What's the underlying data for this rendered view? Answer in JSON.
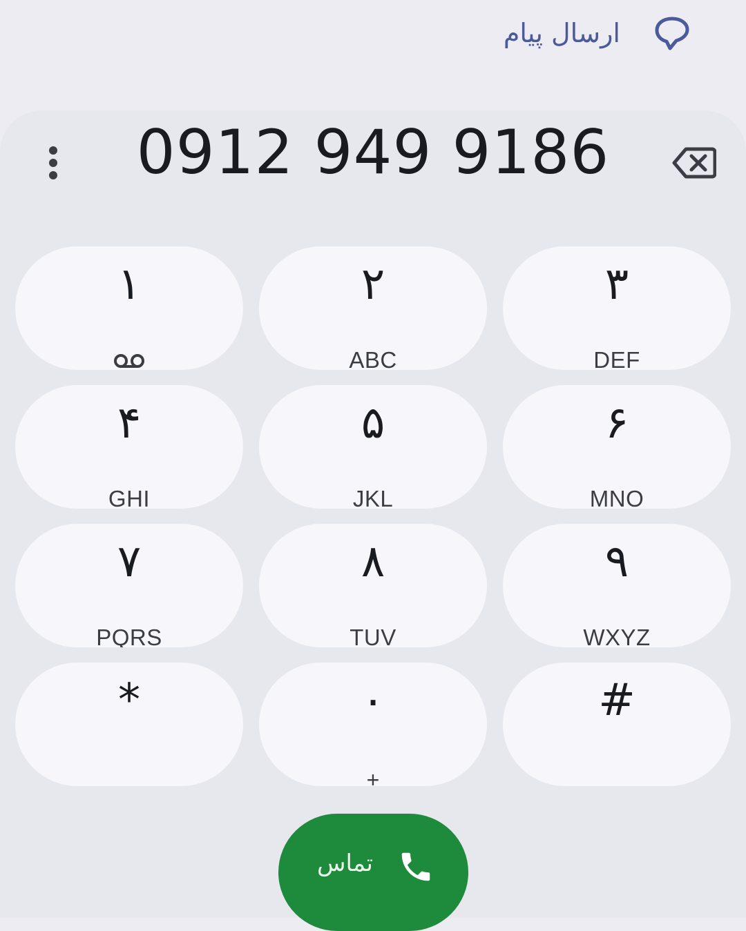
{
  "header": {
    "send_message_label": "ارسال پیام",
    "send_message_icon": "chat-bubble-icon"
  },
  "dialer": {
    "phone_number": "0912 949 9186",
    "menu_icon": "more-vert-icon",
    "backspace_icon": "backspace-icon",
    "keys": [
      {
        "digit": "۱",
        "letters": "",
        "sub_icon": "voicemail-icon"
      },
      {
        "digit": "۲",
        "letters": "ABC"
      },
      {
        "digit": "۳",
        "letters": "DEF"
      },
      {
        "digit": "۴",
        "letters": "GHI"
      },
      {
        "digit": "۵",
        "letters": "JKL"
      },
      {
        "digit": "۶",
        "letters": "MNO"
      },
      {
        "digit": "۷",
        "letters": "PQRS"
      },
      {
        "digit": "۸",
        "letters": "TUV"
      },
      {
        "digit": "۹",
        "letters": "WXYZ"
      },
      {
        "digit": "*",
        "letters": ""
      },
      {
        "digit": "۰",
        "letters": ""
      },
      {
        "digit": "#",
        "letters": ""
      }
    ],
    "zero_sub_label": "+",
    "call_button_label": "تماس",
    "call_icon": "phone-icon"
  },
  "colors": {
    "accent_text": "#4a5a9a",
    "call_green": "#1e8a3c",
    "key_bg": "#f6f6fb",
    "panel_bg": "#e7e7ee",
    "page_bg": "#ececf2"
  }
}
